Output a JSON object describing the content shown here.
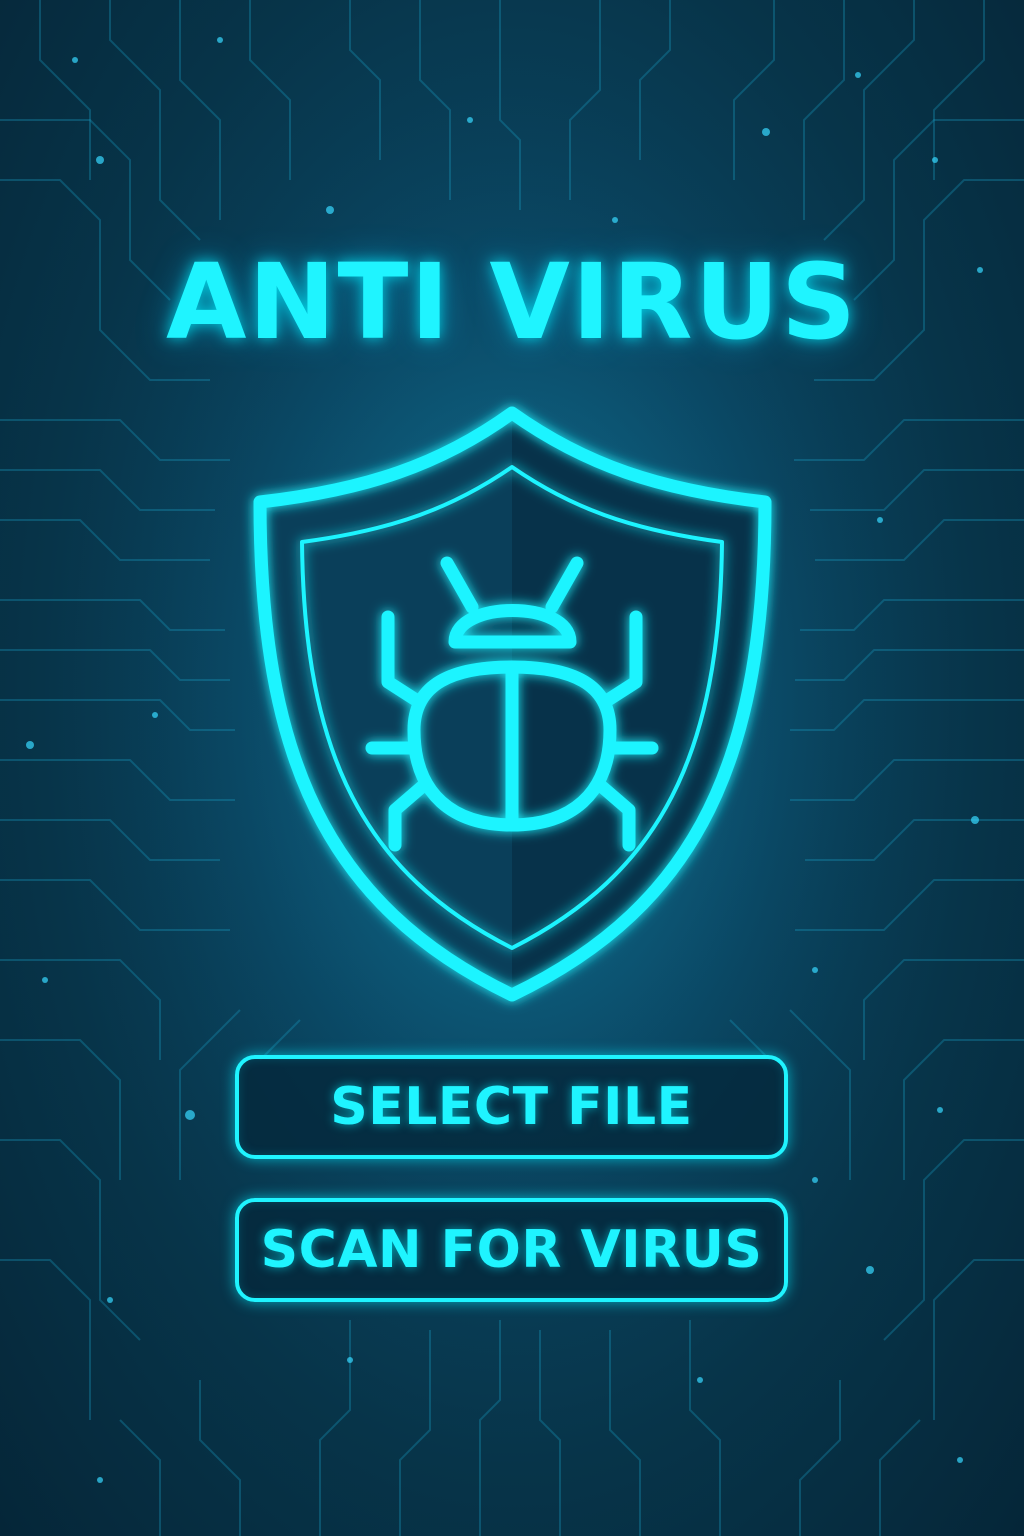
{
  "app": {
    "title": "ANTI VIRUS"
  },
  "logo": {
    "icon": "shield-bug-icon"
  },
  "buttons": {
    "select_file_label": "SELECT FILE",
    "scan_label": "SCAN FOR VIRUS"
  },
  "theme": {
    "accent": "#1ff4ff",
    "background": "#0a4561",
    "background_dark": "#052638",
    "circuit_line": "#1a9fc4"
  }
}
